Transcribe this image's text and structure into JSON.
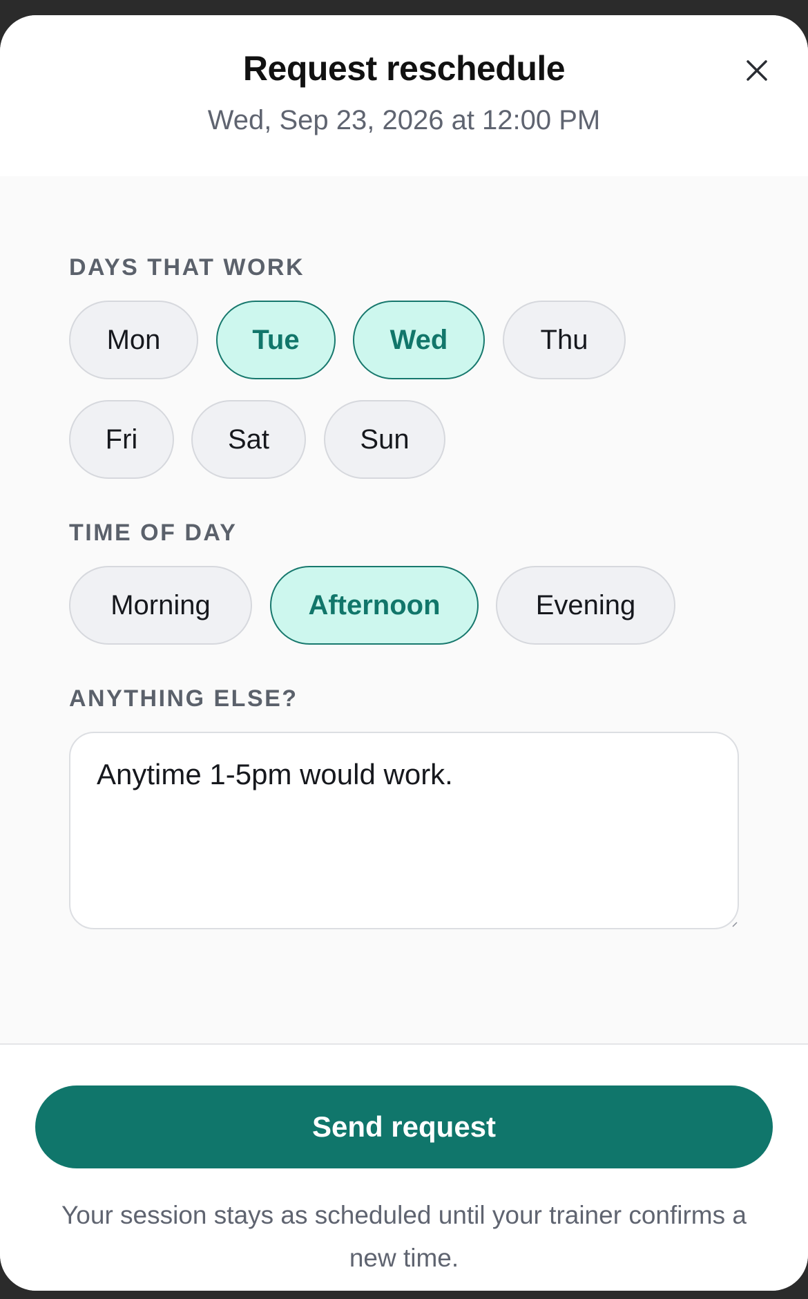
{
  "modal": {
    "title": "Request reschedule",
    "subtitle": "Wed, Sep 23, 2026 at 12:00 PM",
    "close_icon": "close-icon"
  },
  "days": {
    "label": "DAYS THAT WORK",
    "options": [
      {
        "label": "Mon",
        "selected": false
      },
      {
        "label": "Tue",
        "selected": true
      },
      {
        "label": "Wed",
        "selected": true
      },
      {
        "label": "Thu",
        "selected": false
      },
      {
        "label": "Fri",
        "selected": false
      },
      {
        "label": "Sat",
        "selected": false
      },
      {
        "label": "Sun",
        "selected": false
      }
    ]
  },
  "time_of_day": {
    "label": "TIME OF DAY",
    "options": [
      {
        "label": "Morning",
        "selected": false
      },
      {
        "label": "Afternoon",
        "selected": true
      },
      {
        "label": "Evening",
        "selected": false
      }
    ]
  },
  "notes": {
    "label": "ANYTHING ELSE?",
    "value": "Anytime 1-5pm would work."
  },
  "footer": {
    "send_label": "Send request",
    "note": "Your session stays as scheduled until your trainer confirms a new time."
  },
  "colors": {
    "accent": "#10766b",
    "selected_bg": "#cdf7ee",
    "chip_bg": "#f0f1f4"
  }
}
